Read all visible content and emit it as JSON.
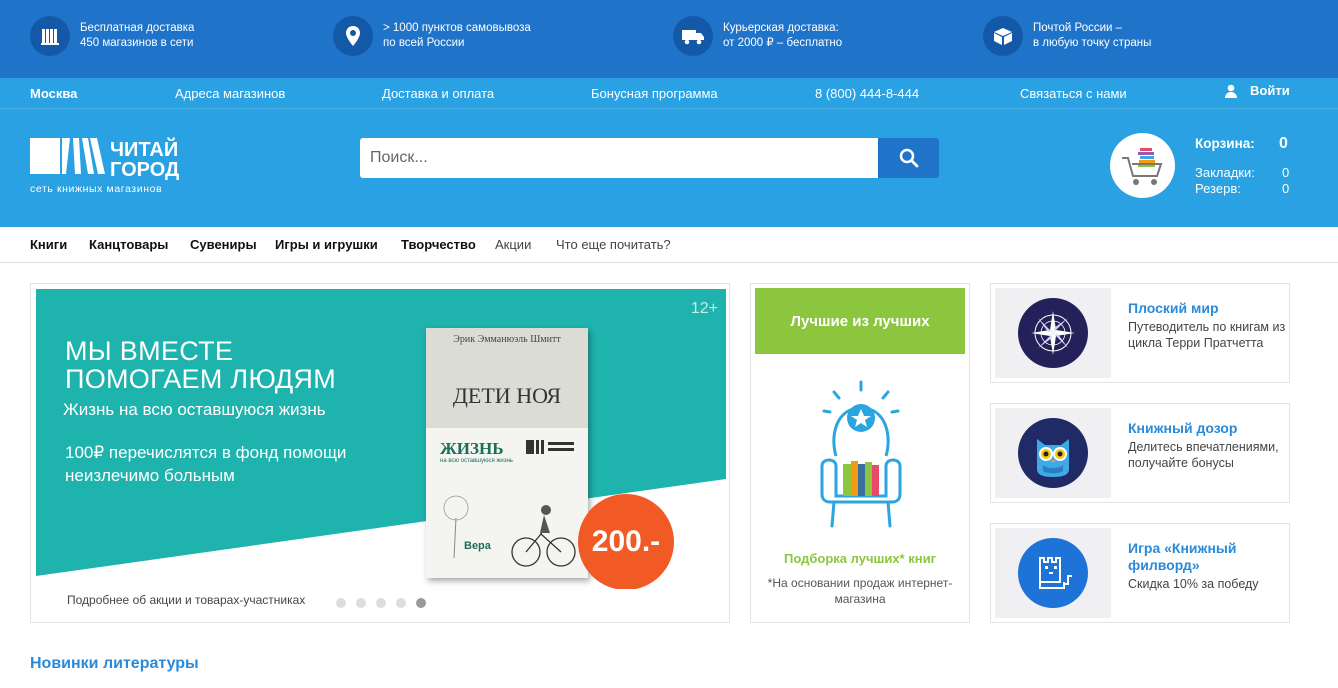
{
  "topbar": {
    "items": [
      {
        "icon": "bookshelf-icon",
        "line1": "Бесплатная доставка",
        "line2": "450 магазинов в сети"
      },
      {
        "icon": "location-pin-icon",
        "line1": "> 1000 пунктов самовывоза",
        "line2": "по всей России"
      },
      {
        "icon": "truck-icon",
        "line1": "Курьерская доставка:",
        "line2": "от 2000 ₽ – бесплатно"
      },
      {
        "icon": "parcel-icon",
        "line1": "Почтой России –",
        "line2": "в любую точку страны"
      }
    ]
  },
  "nav": {
    "city": "Москва",
    "links": [
      "Адреса магазинов",
      "Доставка и оплата",
      "Бонусная программа",
      "8 (800) 444-8-444",
      "Связаться с нами"
    ],
    "login": "Войти"
  },
  "header": {
    "logo_text_1": "ЧИТАЙ",
    "logo_text_2": "ГОРОД",
    "logo_sub": "сеть книжных магазинов",
    "search_placeholder": "Поиск...",
    "cart_label": "Корзина:",
    "cart_count": "0",
    "bookmarks_label": "Закладки:",
    "bookmarks_count": "0",
    "reserve_label": "Резерв:",
    "reserve_count": "0"
  },
  "categories": {
    "bold": [
      "Книги",
      "Канцтовары",
      "Сувениры",
      "Игры и игрушки",
      "Творчество"
    ],
    "normal": [
      "Акции",
      "Что еще почитать?"
    ]
  },
  "banner": {
    "age": "12+",
    "heading_1": "МЫ ВМЕСТЕ",
    "heading_2": "ПОМОГАЕМ ЛЮДЯМ",
    "subtitle": "Жизнь на всю оставшуюся жизнь",
    "text": "100₽ перечислятся в фонд помощи неизлечимо больным",
    "book_author": "Эрик Эмманюэль Шмитт",
    "book_title": "ДЕТИ НОЯ",
    "book_sub": "ЖИЗНЬ",
    "book_sub2": "на всю оставшуюся жизнь",
    "book_fund": "Вера",
    "price": "200.-",
    "footer": "Подробнее об акции и товарах-участниках",
    "active_slide": 5,
    "slides": 5
  },
  "best": {
    "header": "Лучшие из лучших",
    "title": "Подборка лучших* книг",
    "note": "*На основании продаж интернет-магазина"
  },
  "promos": [
    {
      "title": "Плоский мир",
      "desc": "Путеводитель по книгам из цикла Терри Пратчетта",
      "icon": "compass-icon",
      "color": "#24215a"
    },
    {
      "title": "Книжный дозор",
      "desc": "Делитесь впечатлениями, получайте бонусы",
      "icon": "owl-icon",
      "color": "#1f2a66"
    },
    {
      "title": "Игра «Книжный филворд»",
      "desc": "Скидка 10% за победу",
      "icon": "pixel-cat-icon",
      "color": "#1e73d8"
    }
  ],
  "section": {
    "title": "Новинки литературы"
  }
}
